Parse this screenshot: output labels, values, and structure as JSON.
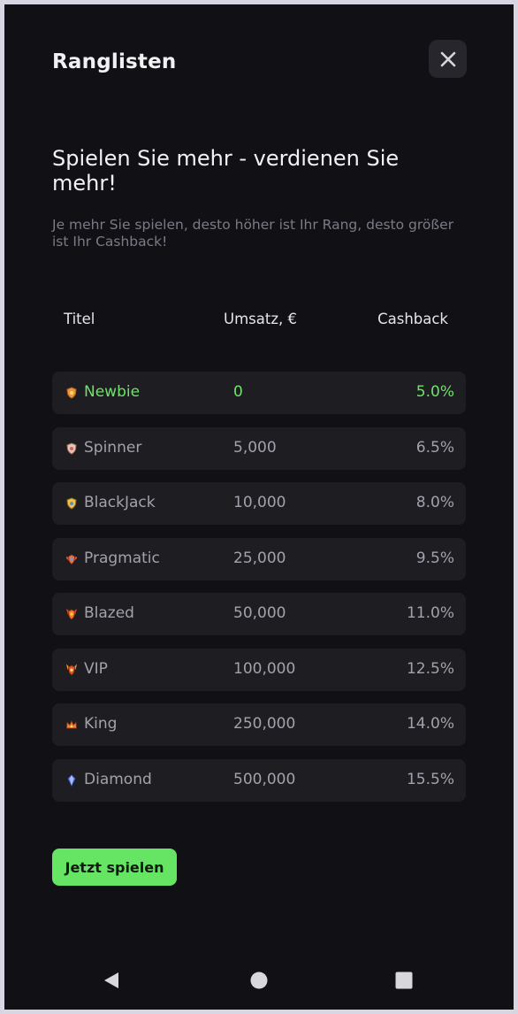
{
  "header": {
    "title": "Ranglisten",
    "close_icon": "close-icon"
  },
  "intro": {
    "headline": "Spielen Sie mehr - verdienen Sie mehr!",
    "subtext": "Je mehr Sie spielen, desto höher ist Ihr Rang, desto größer ist Ihr Cashback!"
  },
  "table": {
    "headers": {
      "title": "Titel",
      "turnover": "Umsatz, €",
      "cashback": "Cashback"
    },
    "rows": [
      {
        "name": "Newbie",
        "turnover": "0",
        "cashback": "5.0%",
        "icon": "shield-bronze-icon",
        "current": true
      },
      {
        "name": "Spinner",
        "turnover": "5,000",
        "cashback": "6.5%",
        "icon": "shield-silver-icon",
        "current": false
      },
      {
        "name": "BlackJack",
        "turnover": "10,000",
        "cashback": "8.0%",
        "icon": "shield-gold-icon",
        "current": false
      },
      {
        "name": "Pragmatic",
        "turnover": "25,000",
        "cashback": "9.5%",
        "icon": "winged-shield-icon",
        "current": false
      },
      {
        "name": "Blazed",
        "turnover": "50,000",
        "cashback": "11.0%",
        "icon": "flame-shield-icon",
        "current": false
      },
      {
        "name": "VIP",
        "turnover": "100,000",
        "cashback": "12.5%",
        "icon": "horned-shield-icon",
        "current": false
      },
      {
        "name": "King",
        "turnover": "250,000",
        "cashback": "14.0%",
        "icon": "crown-icon",
        "current": false
      },
      {
        "name": "Diamond",
        "turnover": "500,000",
        "cashback": "15.5%",
        "icon": "diamond-icon",
        "current": false
      }
    ]
  },
  "cta": {
    "label": "Jetzt spielen"
  },
  "system_nav": {
    "back_icon": "back-triangle-icon",
    "home_icon": "home-circle-icon",
    "recents_icon": "recents-square-icon"
  },
  "colors": {
    "background": "#111115",
    "row_background": "#1d1d22",
    "accent_green": "#66e565",
    "muted_text": "#7b7a86"
  }
}
